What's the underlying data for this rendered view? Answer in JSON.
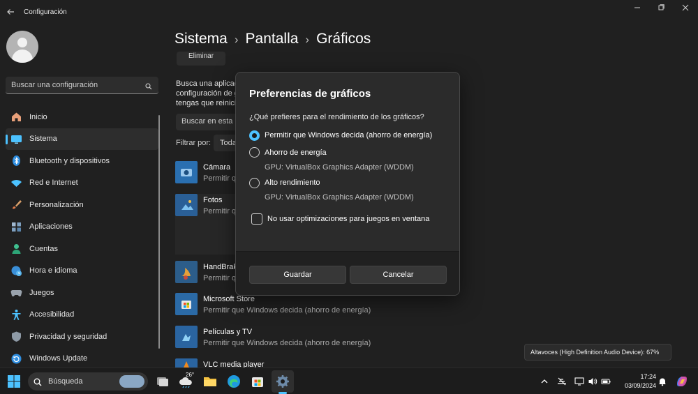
{
  "window": {
    "title": "Configuración",
    "back_icon": "back-arrow-icon",
    "controls": [
      "minimize-icon",
      "maximize-icon",
      "close-icon"
    ]
  },
  "sidebar": {
    "search_placeholder": "Buscar una configuración",
    "items": [
      {
        "label": "Inicio",
        "icon": "home-icon",
        "active": false
      },
      {
        "label": "Sistema",
        "icon": "system-icon",
        "active": true
      },
      {
        "label": "Bluetooth y dispositivos",
        "icon": "bluetooth-icon",
        "active": false
      },
      {
        "label": "Red e Internet",
        "icon": "wifi-icon",
        "active": false
      },
      {
        "label": "Personalización",
        "icon": "brush-icon",
        "active": false
      },
      {
        "label": "Aplicaciones",
        "icon": "apps-icon",
        "active": false
      },
      {
        "label": "Cuentas",
        "icon": "account-icon",
        "active": false
      },
      {
        "label": "Hora e idioma",
        "icon": "globe-clock-icon",
        "active": false
      },
      {
        "label": "Juegos",
        "icon": "gamepad-icon",
        "active": false
      },
      {
        "label": "Accesibilidad",
        "icon": "accessibility-icon",
        "active": false
      },
      {
        "label": "Privacidad y seguridad",
        "icon": "shield-icon",
        "active": false
      },
      {
        "label": "Windows Update",
        "icon": "update-icon",
        "active": false
      }
    ]
  },
  "breadcrumb": [
    "Sistema",
    "Pantalla",
    "Gráficos"
  ],
  "main": {
    "remove_button": "Eliminar",
    "description_lines": [
      "Busca una aplicación",
      "configuración de g",
      "tengas que reinici"
    ],
    "list_search_placeholder": "Buscar en esta li",
    "filter_label": "Filtrar por:",
    "filter_value": "Todas",
    "apps": [
      {
        "name": "Cámara",
        "status": "Permitir q",
        "icon": "camera-icon",
        "expanded": false
      },
      {
        "name": "Fotos",
        "status": "Permitir q",
        "icon": "photos-icon",
        "expanded": true
      },
      {
        "name": "HandBrak",
        "status": "Permitir q",
        "icon": "handbrake-icon",
        "expanded": false
      },
      {
        "name": "Microsoft Store",
        "status": "Permitir que Windows decida (ahorro de energía)",
        "icon": "store-icon",
        "expanded": false
      },
      {
        "name": "Películas y TV",
        "status": "Permitir que Windows decida (ahorro de energía)",
        "icon": "movies-tv-icon",
        "expanded": false
      },
      {
        "name": "VLC media player",
        "status": "",
        "icon": "vlc-icon",
        "expanded": false
      }
    ]
  },
  "dialog": {
    "title": "Preferencias de gráficos",
    "question": "¿Qué prefieres para el rendimiento de los gráficos?",
    "options": [
      {
        "label": "Permitir que Windows decida (ahorro de energía)",
        "sub": "",
        "checked": true
      },
      {
        "label": "Ahorro de energía",
        "sub": "GPU: VirtualBox Graphics Adapter (WDDM)",
        "checked": false
      },
      {
        "label": "Alto rendimiento",
        "sub": "GPU: VirtualBox Graphics Adapter (WDDM)",
        "checked": false
      }
    ],
    "checkbox_label": "No usar optimizaciones para juegos en ventana",
    "checkbox_checked": false,
    "save_label": "Guardar",
    "cancel_label": "Cancelar"
  },
  "tooltip": "Altavoces (High Definition Audio Device): 67%",
  "taskbar": {
    "search_label": "Búsqueda",
    "weather_temp": "26°",
    "pinned": [
      "start-icon",
      "task-view-icon",
      "weather-icon",
      "file-explorer-icon",
      "edge-icon",
      "store-icon",
      "settings-icon"
    ],
    "tray_icons": [
      "chevron-up-icon",
      "network-disconnected-icon",
      "display-icon",
      "volume-icon",
      "battery-icon"
    ],
    "time": "17:24",
    "date": "03/09/2024",
    "accent": "#4cc2ff"
  }
}
